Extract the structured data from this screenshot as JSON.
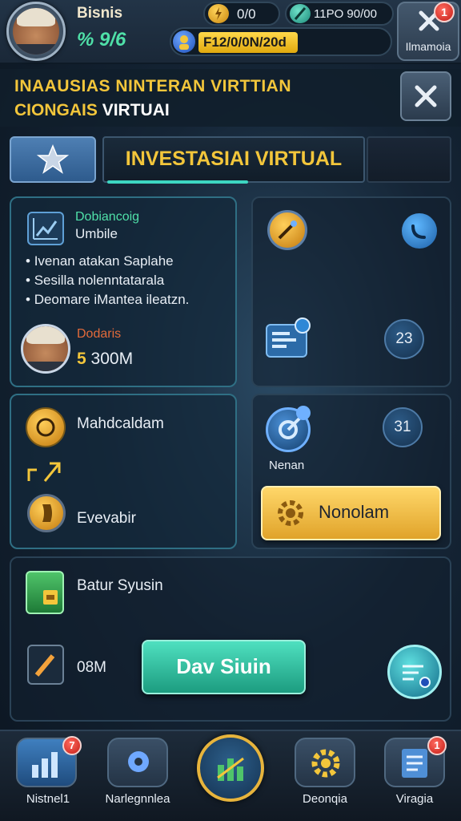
{
  "topbar": {
    "player_name": "Bisnis",
    "player_percent": "% 9/6",
    "coin_value": "0/0",
    "gem_value": "11PO 90/00",
    "currency_bar": "F12/0/0N/20d",
    "close_label": "Ilmamoia",
    "close_badge": "1"
  },
  "header": {
    "title_line1": "INAAUSIAS NINTERAN VIRTTIAN",
    "title_line2_gold": "CIONGAIS",
    "title_line2_white": "VIRTUAI"
  },
  "tabs": {
    "main_label": "INVESTASIAI VIRTUAL"
  },
  "card_left_top": {
    "heading_green": "Dobiancoig",
    "heading_white": "Umbile",
    "bullets": [
      "Ivenan atakan Saplahe",
      "Sesilla nolenntatarala",
      "Deomare iMantea ileatzn."
    ],
    "bullet_prefix": "•",
    "profile_label": "Dodaris",
    "profile_value_gold": "5",
    "profile_value": "300M"
  },
  "card_right_top": {
    "badge_value": "23"
  },
  "card_left_mid": {
    "row1_label": "Mahdcaldam",
    "row2_label": "Evevabir"
  },
  "card_right_mid": {
    "badge_value": "31",
    "icon_label": "Nenan",
    "button_label": "Nonolam"
  },
  "card_bottom": {
    "heading": "Batur Syusin",
    "value": "08M",
    "button_label": "Dav Siuin"
  },
  "bottom_nav": {
    "items": [
      {
        "label": "Nistnel1",
        "badge": "7"
      },
      {
        "label": "Narlegnnlea",
        "badge": ""
      },
      {
        "label": "",
        "badge": ""
      },
      {
        "label": "Deonqia",
        "badge": ""
      },
      {
        "label": "Viragia",
        "badge": "1"
      }
    ]
  },
  "colors": {
    "accent_gold": "#f3c63b",
    "accent_teal": "#3dd6c1",
    "accent_green": "#4fe0a8",
    "badge_red": "#c41d17"
  }
}
